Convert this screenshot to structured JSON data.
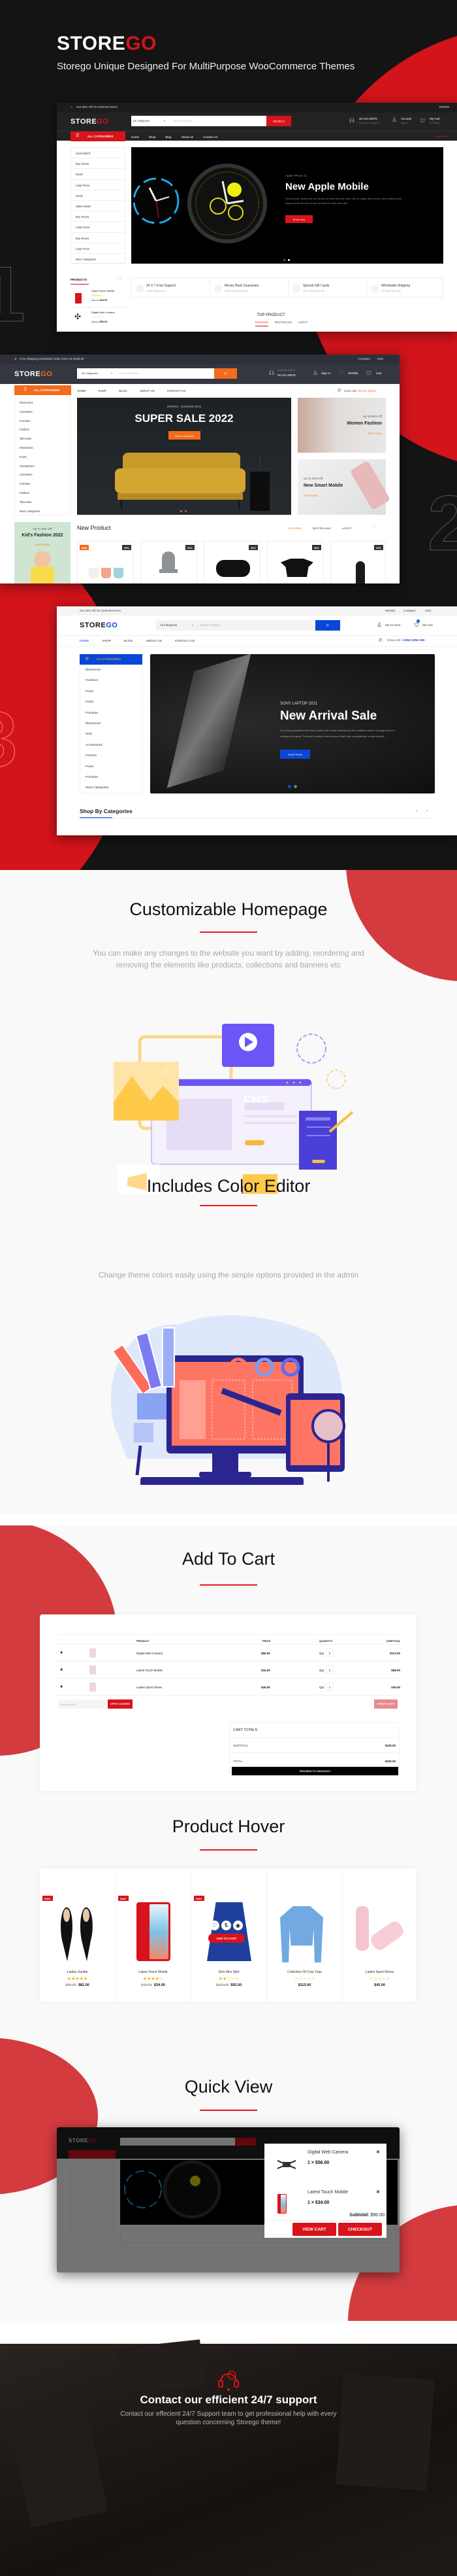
{
  "colors": {
    "brand_red": "#d8131b",
    "dark_bg": "#141414",
    "orange": "#f56a1c",
    "blue": "#0a47d6",
    "light_bg": "#f9f9f9"
  },
  "hero": {
    "logo_store": "STORE",
    "logo_go": "GO",
    "tagline": "Storego Unique Designed For MultiPurpose WooCommerce Themes",
    "numbers": [
      "1",
      "2",
      "3"
    ]
  },
  "screen1": {
    "topbar_offer": "Get 30% Off On Selected Items",
    "wishlist": "Wishlist",
    "logo_store": "STORE",
    "logo_go": "GO",
    "search_category": "All Categories",
    "search_placeholder": "Search Products...",
    "search_button": "SEARCH",
    "phone": "28 123 45678",
    "phone_sub": "Customer Support",
    "account": "Account",
    "account_sub": "Sign In",
    "cart": "My Cart",
    "cart_sub": "(0 Items)",
    "all_categories": "ALL CATEGORIES",
    "nav": [
      "Home",
      "Shop",
      "Blog",
      "About Us",
      "Contact Us"
    ],
    "special_offer": "Special Offer",
    "categories": [
      "Hand Watch",
      "Boy Shoes",
      "Brush",
      "Lady Purse",
      "Heels",
      "Water Bottle",
      "Boy Shoes",
      "Lady Purse",
      "Boy Shoes",
      "Lady Purse",
      "More Categories"
    ],
    "banner": {
      "eyebrow": "Apple iPhone 11",
      "title": "New Apple Mobile",
      "desc": "Sed sit quam, iaculis the sed semper sit amet the udin vitae nibh at magna akal semper sems dialup sems dialup iaculis the sed semper sit amet the udin vitae nibh.",
      "button": "Shop Now"
    },
    "features": [
      {
        "title": "24 X 7 Free Support",
        "sub": "Online Support 24/7"
      },
      {
        "title": "Money Back Guarantee",
        "sub": "100% Secure Payment"
      },
      {
        "title": "Special Gift Cards",
        "sub": "Give The Perfect Gift"
      },
      {
        "title": "Worldwide Shipping",
        "sub": "On Order Over $99"
      }
    ],
    "products_label": "PRODUCTS",
    "products": [
      {
        "name": "Latest Touch Mobile",
        "old": "$41.00",
        "price": "$34.00"
      },
      {
        "name": "Digital Web Camera",
        "old": "$66.00",
        "price": "$56.00"
      }
    ],
    "top_product": "TOP PRODUCT",
    "tabs": [
      "FEATURED",
      "BESTSELLING",
      "LATEST"
    ]
  },
  "screen2": {
    "topbar_offer": "Free Shipping Worldwide Order Over On $199.00",
    "compare": "Compare",
    "currency": "USD",
    "logo_store": "STORE",
    "logo_go": "GO",
    "search_category": "All Categories",
    "search_placeholder": "Search Products...",
    "support_label": "customer support",
    "phone": "28 123 45678",
    "sign_in": "Sign In",
    "wishlist": "Wishlist",
    "cart": "Cart",
    "all_categories": "ALL CATEGORIES",
    "nav": [
      "HOME",
      "SHOP",
      "BLOG",
      "ABOUT US",
      "CONTACT US"
    ],
    "call_label": "CALL US:",
    "call_number": "28 123 45678",
    "categories": [
      "Electronics",
      "Cosmetics",
      "Furniture",
      "Fashion",
      "Television",
      "Electronics",
      "Fruits",
      "Smartphone",
      "Cosmetics",
      "Furniture",
      "Fashion",
      "Television",
      "More Categories"
    ],
    "banner": {
      "eyebrow": "SPRING - SUMMER 2022",
      "title": "SUPER SALE 2022",
      "button": "View Collections"
    },
    "side_banners": [
      {
        "eyebrow": "Up To 60% Off",
        "title": "Women Fashion",
        "link": "SHOP NOW"
      },
      {
        "eyebrow": "Up To 30% Off",
        "title": "New Smart Mobile",
        "link": "SHOP NOW"
      }
    ],
    "kid_banner": {
      "eyebrow": "Up To 20% Off",
      "title": "Kid's Fashion 2022",
      "link": "SHOP NOW"
    },
    "new_product": "New Product",
    "tabs": [
      "FEATURED",
      "BESTSELLING",
      "LATEST"
    ],
    "product_new_badge": "New",
    "product_discounts": [
      "49%",
      "60%",
      "26%",
      "59%",
      "29%"
    ]
  },
  "screen3": {
    "topbar_offer": "Get 30% Off On Selected Items",
    "wishlist": "Wishlist",
    "compare": "Compare",
    "currency": "USD",
    "logo_store": "STORE",
    "logo_go": "GO",
    "search_category": "All Categories",
    "search_placeholder": "Search Products...",
    "account": "My Account",
    "cart": "My Cart",
    "cart_count": "0",
    "nav": [
      "HOME",
      "SHOP",
      "BLOG",
      "ABOUT US",
      "CONTACT US"
    ],
    "call_label": "CALL US:",
    "call_number": "+2354 3256 326",
    "all_categories": "ALL CATEGORIES",
    "categories": [
      "Electronics",
      "Furniture",
      "Fruits",
      "Fruits",
      "Furniture",
      "Electronics",
      "Sofa",
      "Accessories",
      "Fashion",
      "Fruits",
      "Furniture",
      "More Categories"
    ],
    "banner": {
      "eyebrow": "SONY LAPTOP 2021",
      "title": "New Arrival Sale",
      "desc": "It is a long established fact that a reader will be that distracted by the readable content of a page when in looking at its layout. The point of using Lorem Ipsum is that it has a adablemore-or-less normal...",
      "button": "SHOP NOW"
    },
    "shop_by_categories": "Shop By Categories"
  },
  "customizable": {
    "title": "Customizable Homepage",
    "desc": "You can make any changes to the website you want by adding, reordering and removing the elements like products, collections and banners etc",
    "cms_label": "CMS"
  },
  "color_editor": {
    "title": "Includes Color Editor",
    "desc": "Change theme colors easily using the simple options provided in the admin"
  },
  "cart": {
    "title": "Add To Cart",
    "headers": [
      "PRODUCT",
      "PRICE",
      "QUANTITY",
      "SUBTOTAL"
    ],
    "qty_label": "Qty:",
    "rows": [
      {
        "name": "Digital Web Camera",
        "price": "$56.00",
        "qty": "2",
        "subtotal": "$112.00"
      },
      {
        "name": "Latest Touch Mobile",
        "price": "$34.00",
        "qty": "2",
        "subtotal": "$68.00"
      },
      {
        "name": "Ladies Sport Shoes",
        "price": "$45.00",
        "qty": "1",
        "subtotal": "$45.00"
      }
    ],
    "coupon_placeholder": "Coupon code",
    "apply_coupon": "APPLY COUPON",
    "update_cart": "UPDATE CART",
    "totals_title": "CART TOTALS",
    "subtotal_label": "SUBTOTAL",
    "subtotal": "$225.00",
    "total_label": "TOTAL",
    "total": "$225.00",
    "checkout": "PROCEED TO CHECKOUT"
  },
  "hover": {
    "title": "Product Hover",
    "sale_badge": "Sale!",
    "add_to_cart": "ADD TO CART",
    "products": [
      {
        "name": "Ladies Sandle",
        "old": "$86.00",
        "price": "$82.00",
        "rating": 5,
        "sale": true
      },
      {
        "name": "Latest Touch Mobile",
        "old": "$41.00",
        "price": "$34.00",
        "rating": 4,
        "sale": true
      },
      {
        "name": "Girls Mini Skirt",
        "old": "$110.00",
        "price": "$92.00",
        "rating": 2,
        "sale": true
      },
      {
        "name": "Collection Of Crop Tops",
        "old": "",
        "price": "$115.00",
        "rating": 0,
        "sale": false
      },
      {
        "name": "Ladies Sport Shoes",
        "old": "",
        "price": "$45.00",
        "rating": 0,
        "sale": false
      }
    ]
  },
  "quick_view": {
    "title": "Quick View",
    "items": [
      {
        "name": "Digital Web Camera",
        "qty_price": "1 × $56.00"
      },
      {
        "name": "Latest Touch Mobile",
        "qty_price": "1 × $34.00"
      }
    ],
    "subtotal_label": "Subtotal:",
    "subtotal": "$90.00",
    "view_cart": "VIEW CART",
    "checkout": "CHECKOUT"
  },
  "support": {
    "title": "Contact our efficient 24/7 support",
    "desc_line1": "Contact our effecient 24/7 Support team to get professional help with every",
    "desc_line2": "question concerning Storego theme!"
  }
}
